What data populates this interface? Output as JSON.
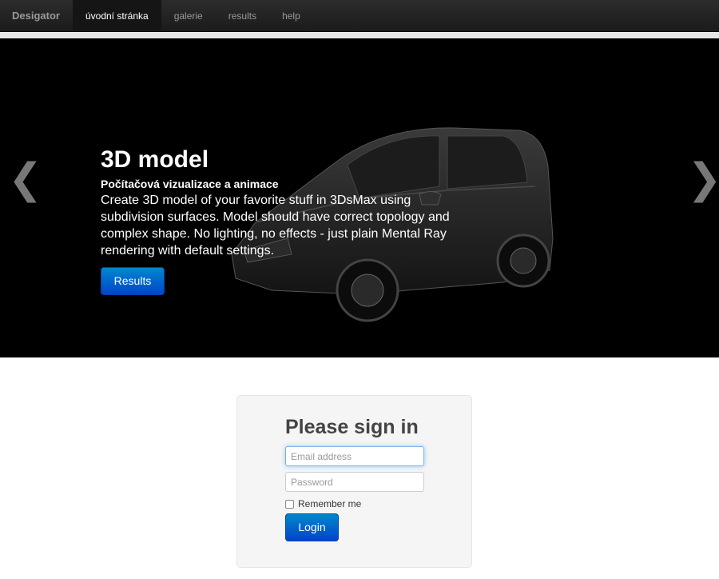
{
  "navbar": {
    "brand": "Desigator",
    "items": [
      {
        "label": "úvodní stránka",
        "active": true
      },
      {
        "label": "galerie",
        "active": false
      },
      {
        "label": "results",
        "active": false
      },
      {
        "label": "help",
        "active": false
      }
    ]
  },
  "carousel": {
    "prev_glyph": "❮",
    "next_glyph": "❯",
    "title": "3D model",
    "subtitle": "Počítačová vizualizace a animace",
    "description": "Create 3D model of your favorite stuff in 3DsMax using subdivision surfaces. Model should have correct topology and complex shape. No lighting, no effects - just plain Mental Ray rendering with default settings.",
    "button_label": "Results"
  },
  "signin": {
    "heading": "Please sign in",
    "email_placeholder": "Email address",
    "password_placeholder": "Password",
    "remember_label": "Remember me",
    "button_label": "Login"
  },
  "colors": {
    "primary": "#0055cc",
    "navbar": "#1b1b1b"
  }
}
